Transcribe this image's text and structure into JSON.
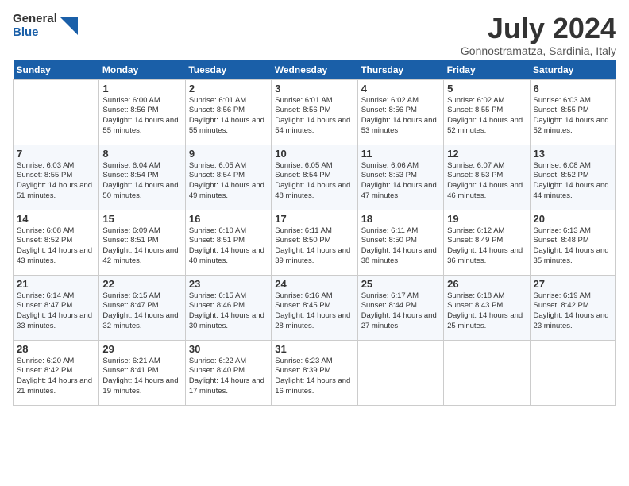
{
  "logo": {
    "general": "General",
    "blue": "Blue"
  },
  "title": "July 2024",
  "subtitle": "Gonnostramatza, Sardinia, Italy",
  "headers": [
    "Sunday",
    "Monday",
    "Tuesday",
    "Wednesday",
    "Thursday",
    "Friday",
    "Saturday"
  ],
  "weeks": [
    [
      {
        "day": "",
        "sunrise": "",
        "sunset": "",
        "daylight": ""
      },
      {
        "day": "1",
        "sunrise": "Sunrise: 6:00 AM",
        "sunset": "Sunset: 8:56 PM",
        "daylight": "Daylight: 14 hours and 55 minutes."
      },
      {
        "day": "2",
        "sunrise": "Sunrise: 6:01 AM",
        "sunset": "Sunset: 8:56 PM",
        "daylight": "Daylight: 14 hours and 55 minutes."
      },
      {
        "day": "3",
        "sunrise": "Sunrise: 6:01 AM",
        "sunset": "Sunset: 8:56 PM",
        "daylight": "Daylight: 14 hours and 54 minutes."
      },
      {
        "day": "4",
        "sunrise": "Sunrise: 6:02 AM",
        "sunset": "Sunset: 8:56 PM",
        "daylight": "Daylight: 14 hours and 53 minutes."
      },
      {
        "day": "5",
        "sunrise": "Sunrise: 6:02 AM",
        "sunset": "Sunset: 8:55 PM",
        "daylight": "Daylight: 14 hours and 52 minutes."
      },
      {
        "day": "6",
        "sunrise": "Sunrise: 6:03 AM",
        "sunset": "Sunset: 8:55 PM",
        "daylight": "Daylight: 14 hours and 52 minutes."
      }
    ],
    [
      {
        "day": "7",
        "sunrise": "Sunrise: 6:03 AM",
        "sunset": "Sunset: 8:55 PM",
        "daylight": "Daylight: 14 hours and 51 minutes."
      },
      {
        "day": "8",
        "sunrise": "Sunrise: 6:04 AM",
        "sunset": "Sunset: 8:54 PM",
        "daylight": "Daylight: 14 hours and 50 minutes."
      },
      {
        "day": "9",
        "sunrise": "Sunrise: 6:05 AM",
        "sunset": "Sunset: 8:54 PM",
        "daylight": "Daylight: 14 hours and 49 minutes."
      },
      {
        "day": "10",
        "sunrise": "Sunrise: 6:05 AM",
        "sunset": "Sunset: 8:54 PM",
        "daylight": "Daylight: 14 hours and 48 minutes."
      },
      {
        "day": "11",
        "sunrise": "Sunrise: 6:06 AM",
        "sunset": "Sunset: 8:53 PM",
        "daylight": "Daylight: 14 hours and 47 minutes."
      },
      {
        "day": "12",
        "sunrise": "Sunrise: 6:07 AM",
        "sunset": "Sunset: 8:53 PM",
        "daylight": "Daylight: 14 hours and 46 minutes."
      },
      {
        "day": "13",
        "sunrise": "Sunrise: 6:08 AM",
        "sunset": "Sunset: 8:52 PM",
        "daylight": "Daylight: 14 hours and 44 minutes."
      }
    ],
    [
      {
        "day": "14",
        "sunrise": "Sunrise: 6:08 AM",
        "sunset": "Sunset: 8:52 PM",
        "daylight": "Daylight: 14 hours and 43 minutes."
      },
      {
        "day": "15",
        "sunrise": "Sunrise: 6:09 AM",
        "sunset": "Sunset: 8:51 PM",
        "daylight": "Daylight: 14 hours and 42 minutes."
      },
      {
        "day": "16",
        "sunrise": "Sunrise: 6:10 AM",
        "sunset": "Sunset: 8:51 PM",
        "daylight": "Daylight: 14 hours and 40 minutes."
      },
      {
        "day": "17",
        "sunrise": "Sunrise: 6:11 AM",
        "sunset": "Sunset: 8:50 PM",
        "daylight": "Daylight: 14 hours and 39 minutes."
      },
      {
        "day": "18",
        "sunrise": "Sunrise: 6:11 AM",
        "sunset": "Sunset: 8:50 PM",
        "daylight": "Daylight: 14 hours and 38 minutes."
      },
      {
        "day": "19",
        "sunrise": "Sunrise: 6:12 AM",
        "sunset": "Sunset: 8:49 PM",
        "daylight": "Daylight: 14 hours and 36 minutes."
      },
      {
        "day": "20",
        "sunrise": "Sunrise: 6:13 AM",
        "sunset": "Sunset: 8:48 PM",
        "daylight": "Daylight: 14 hours and 35 minutes."
      }
    ],
    [
      {
        "day": "21",
        "sunrise": "Sunrise: 6:14 AM",
        "sunset": "Sunset: 8:47 PM",
        "daylight": "Daylight: 14 hours and 33 minutes."
      },
      {
        "day": "22",
        "sunrise": "Sunrise: 6:15 AM",
        "sunset": "Sunset: 8:47 PM",
        "daylight": "Daylight: 14 hours and 32 minutes."
      },
      {
        "day": "23",
        "sunrise": "Sunrise: 6:15 AM",
        "sunset": "Sunset: 8:46 PM",
        "daylight": "Daylight: 14 hours and 30 minutes."
      },
      {
        "day": "24",
        "sunrise": "Sunrise: 6:16 AM",
        "sunset": "Sunset: 8:45 PM",
        "daylight": "Daylight: 14 hours and 28 minutes."
      },
      {
        "day": "25",
        "sunrise": "Sunrise: 6:17 AM",
        "sunset": "Sunset: 8:44 PM",
        "daylight": "Daylight: 14 hours and 27 minutes."
      },
      {
        "day": "26",
        "sunrise": "Sunrise: 6:18 AM",
        "sunset": "Sunset: 8:43 PM",
        "daylight": "Daylight: 14 hours and 25 minutes."
      },
      {
        "day": "27",
        "sunrise": "Sunrise: 6:19 AM",
        "sunset": "Sunset: 8:42 PM",
        "daylight": "Daylight: 14 hours and 23 minutes."
      }
    ],
    [
      {
        "day": "28",
        "sunrise": "Sunrise: 6:20 AM",
        "sunset": "Sunset: 8:42 PM",
        "daylight": "Daylight: 14 hours and 21 minutes."
      },
      {
        "day": "29",
        "sunrise": "Sunrise: 6:21 AM",
        "sunset": "Sunset: 8:41 PM",
        "daylight": "Daylight: 14 hours and 19 minutes."
      },
      {
        "day": "30",
        "sunrise": "Sunrise: 6:22 AM",
        "sunset": "Sunset: 8:40 PM",
        "daylight": "Daylight: 14 hours and 17 minutes."
      },
      {
        "day": "31",
        "sunrise": "Sunrise: 6:23 AM",
        "sunset": "Sunset: 8:39 PM",
        "daylight": "Daylight: 14 hours and 16 minutes."
      },
      {
        "day": "",
        "sunrise": "",
        "sunset": "",
        "daylight": ""
      },
      {
        "day": "",
        "sunrise": "",
        "sunset": "",
        "daylight": ""
      },
      {
        "day": "",
        "sunrise": "",
        "sunset": "",
        "daylight": ""
      }
    ]
  ]
}
